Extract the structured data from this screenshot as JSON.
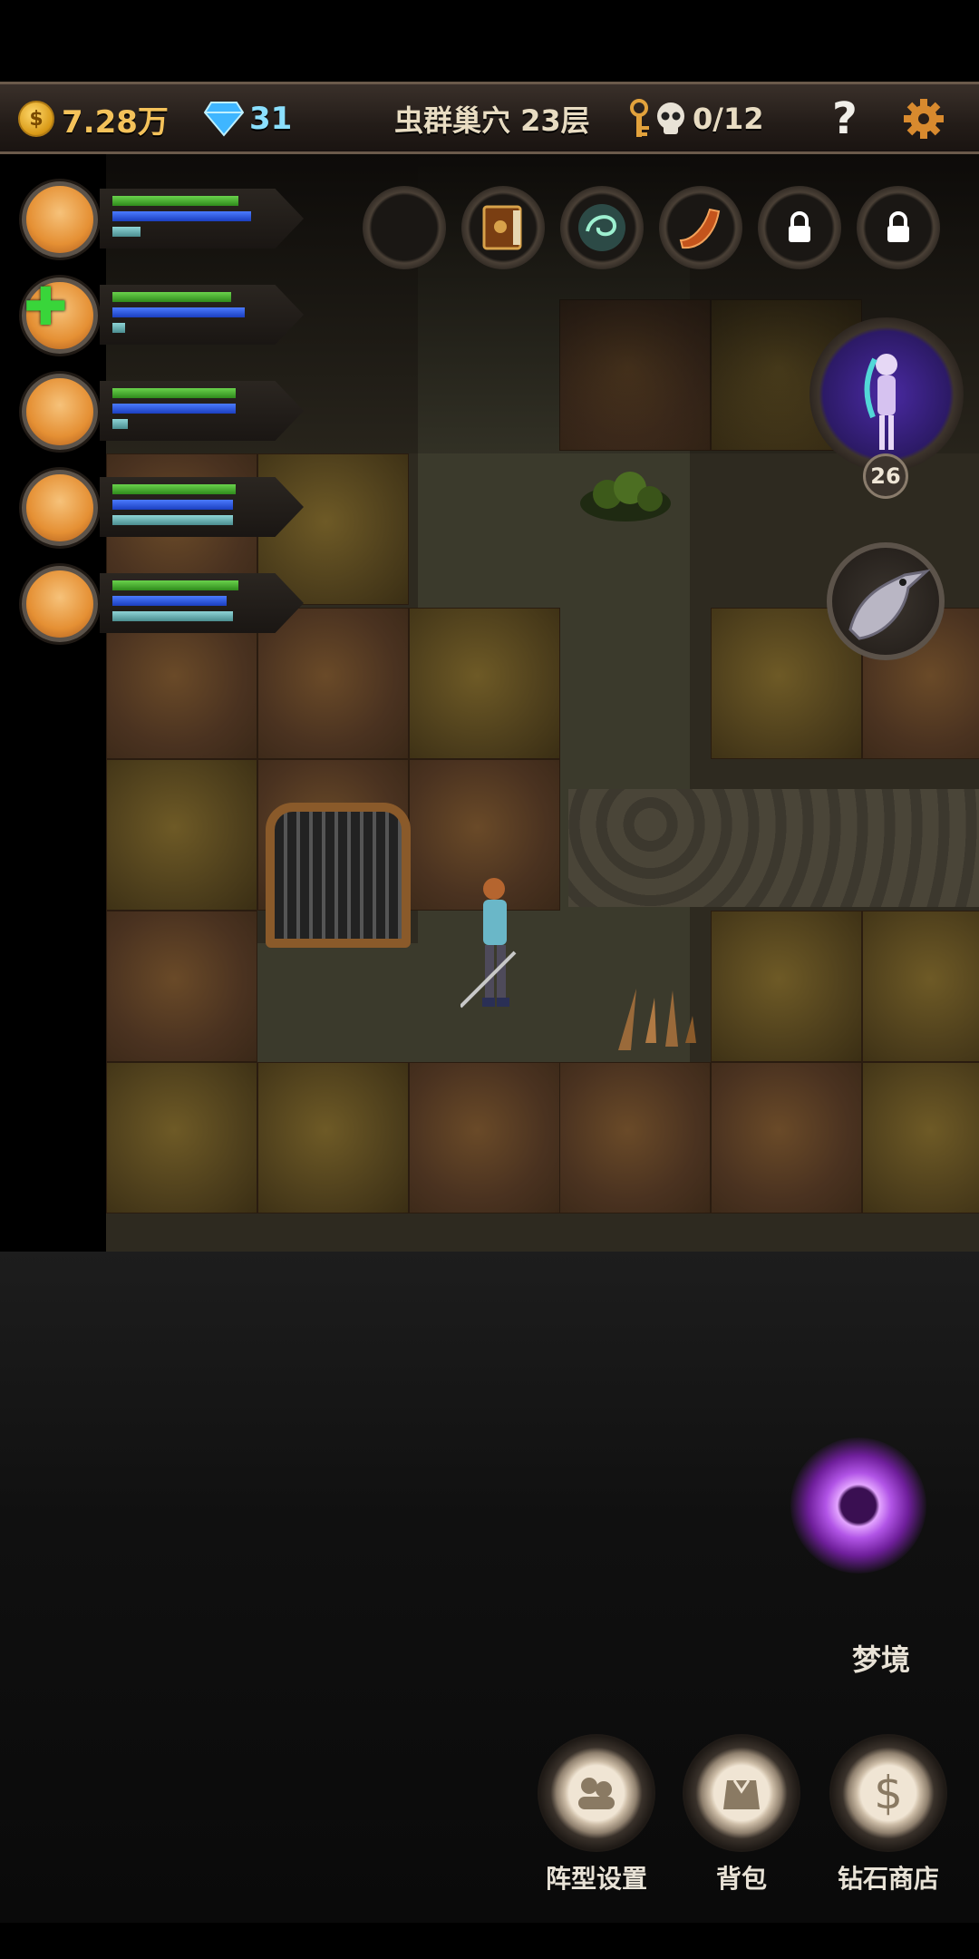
{
  "top_bar": {
    "gold": "7.28万",
    "gems": "31",
    "floor": "虫群巢穴 23层",
    "kills": "0/12",
    "help_label": "?",
    "colors": {
      "gold": "#f4c25a",
      "gems": "#8be0ff",
      "text": "#e8dcc2"
    }
  },
  "party": [
    {
      "name": "hero-1",
      "hp": 0.82,
      "mp": 0.9,
      "xp": 0.18,
      "status": ""
    },
    {
      "name": "hero-2",
      "hp": 0.77,
      "mp": 0.86,
      "xp": 0.08,
      "status": "plus-icon"
    },
    {
      "name": "hero-3",
      "hp": 0.8,
      "mp": 0.8,
      "xp": 0.1,
      "status": ""
    },
    {
      "name": "hero-4",
      "hp": 0.8,
      "mp": 0.78,
      "xp": 0.78,
      "status": ""
    },
    {
      "name": "hero-5",
      "hp": 0.82,
      "mp": 0.74,
      "xp": 0.78,
      "status": ""
    }
  ],
  "item_slots": [
    {
      "icon": "empty-slot",
      "locked": false
    },
    {
      "icon": "book-icon",
      "locked": false
    },
    {
      "icon": "swirl-orb-icon",
      "locked": false
    },
    {
      "icon": "horn-icon",
      "locked": false
    },
    {
      "icon": "lock-icon",
      "locked": true
    },
    {
      "icon": "lock-icon",
      "locked": true
    }
  ],
  "boss": {
    "level": "26"
  },
  "portal": {
    "label": "梦境"
  },
  "menu": {
    "formation": "阵型设置",
    "bag": "背包",
    "shop": "钻石商店"
  }
}
